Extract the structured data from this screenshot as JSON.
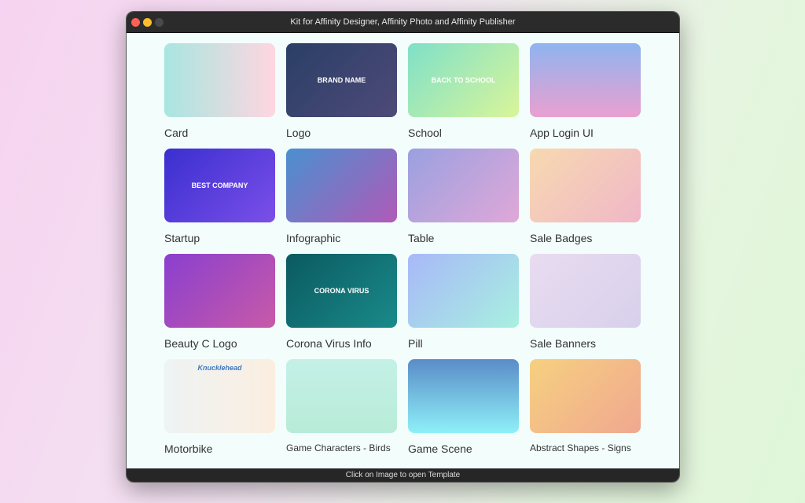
{
  "window": {
    "title": "Kit for Affinity Designer, Affinity Photo and Affinity Publisher"
  },
  "footer": {
    "text": "Click on Image to open Template"
  },
  "templates": [
    {
      "label": "Card",
      "gradient": "linear-gradient(90deg,#a8e6e0,#ffd6e0)"
    },
    {
      "label": "Logo",
      "gradient": "linear-gradient(135deg,#2a3f66,#4e4a78)",
      "text": "BRAND NAME"
    },
    {
      "label": "School",
      "gradient": "linear-gradient(135deg,#7fe0c8,#d9f59a)",
      "text": "BACK TO SCHOOL"
    },
    {
      "label": "App Login UI",
      "gradient": "linear-gradient(180deg,#8fb4f0,#e9a0d0)"
    },
    {
      "label": "Startup",
      "gradient": "linear-gradient(135deg,#3a2fd0,#7b4fe8)",
      "text": "BEST COMPANY"
    },
    {
      "label": "Infographic",
      "gradient": "linear-gradient(135deg,#4a90d0,#b05ab8)"
    },
    {
      "label": "Table",
      "gradient": "linear-gradient(135deg,#9aa0e0,#e0a8d8)"
    },
    {
      "label": "Sale Badges",
      "gradient": "linear-gradient(135deg,#f7d9b0,#f0b7c8)"
    },
    {
      "label": "Beauty C Logo",
      "gradient": "linear-gradient(135deg,#8a3fcf,#c85aa8)"
    },
    {
      "label": "Corona Virus Info",
      "gradient": "linear-gradient(135deg,#0a5a60,#1a8a8a)",
      "text": "CORONA VIRUS"
    },
    {
      "label": "Pill",
      "gradient": "linear-gradient(135deg,#a8b8f8,#a8f0e0)"
    },
    {
      "label": "Sale Banners",
      "gradient": "linear-gradient(135deg,#e8dcf0,#d8d0ec)"
    },
    {
      "label": "Motorbike",
      "gradient": "linear-gradient(90deg,#eef3f4,#fbeee0)",
      "text": "Knucklehead"
    },
    {
      "label": "Game Characters - Birds",
      "gradient": "linear-gradient(180deg,#c4f0e6,#b8ecd8)",
      "small": true
    },
    {
      "label": "Game Scene",
      "gradient": "linear-gradient(180deg,#5a8cc8,#8ef0f8)"
    },
    {
      "label": "Abstract Shapes - Signs",
      "gradient": "linear-gradient(135deg,#f6d080,#f0a890)",
      "small": true
    }
  ]
}
